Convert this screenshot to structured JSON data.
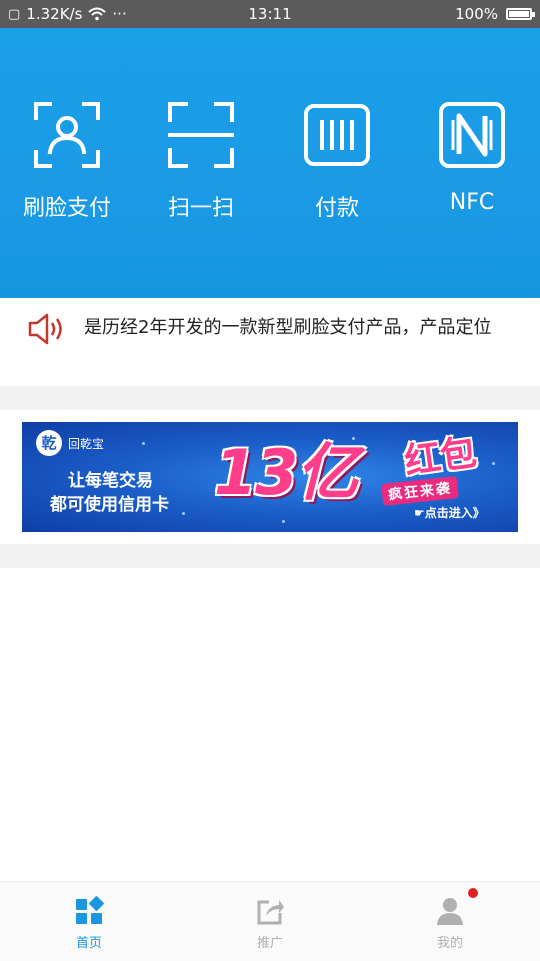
{
  "status_bar": {
    "network_speed": "1.32K/s",
    "more": "···",
    "time": "13:11",
    "battery": "100%",
    "battery_level": 1.0
  },
  "actions": [
    {
      "label": "刷脸支付",
      "icon": "face-scan-icon"
    },
    {
      "label": "扫一扫",
      "icon": "scan-icon"
    },
    {
      "label": "付款",
      "icon": "barcode-pay-icon"
    },
    {
      "label": "NFC",
      "icon": "nfc-icon"
    }
  ],
  "notice": {
    "icon": "speaker-icon",
    "text": "是历经2年开发的一款新型刷脸支付产品，产品定位"
  },
  "banner": {
    "logo_mark": "乾",
    "logo_text": "回乾宝",
    "line1": "让每笔交易",
    "line2": "都可使用信用卡",
    "big_text": "13亿",
    "red_text": "红包",
    "sub_text": "疯狂来袭",
    "cta": "☛点击进入》"
  },
  "tabbar": {
    "items": [
      {
        "label": "首页",
        "icon": "home-grid-icon",
        "active": true
      },
      {
        "label": "推广",
        "icon": "share-icon",
        "active": false
      },
      {
        "label": "我的",
        "icon": "user-icon",
        "active": false
      }
    ],
    "badge_dot": true
  },
  "colors": {
    "primary": "#1b9ae6",
    "tab_active": "#1b96e0",
    "tab_inactive": "#b0b0b0",
    "badge": "#e02020",
    "speaker": "#c0392b"
  }
}
